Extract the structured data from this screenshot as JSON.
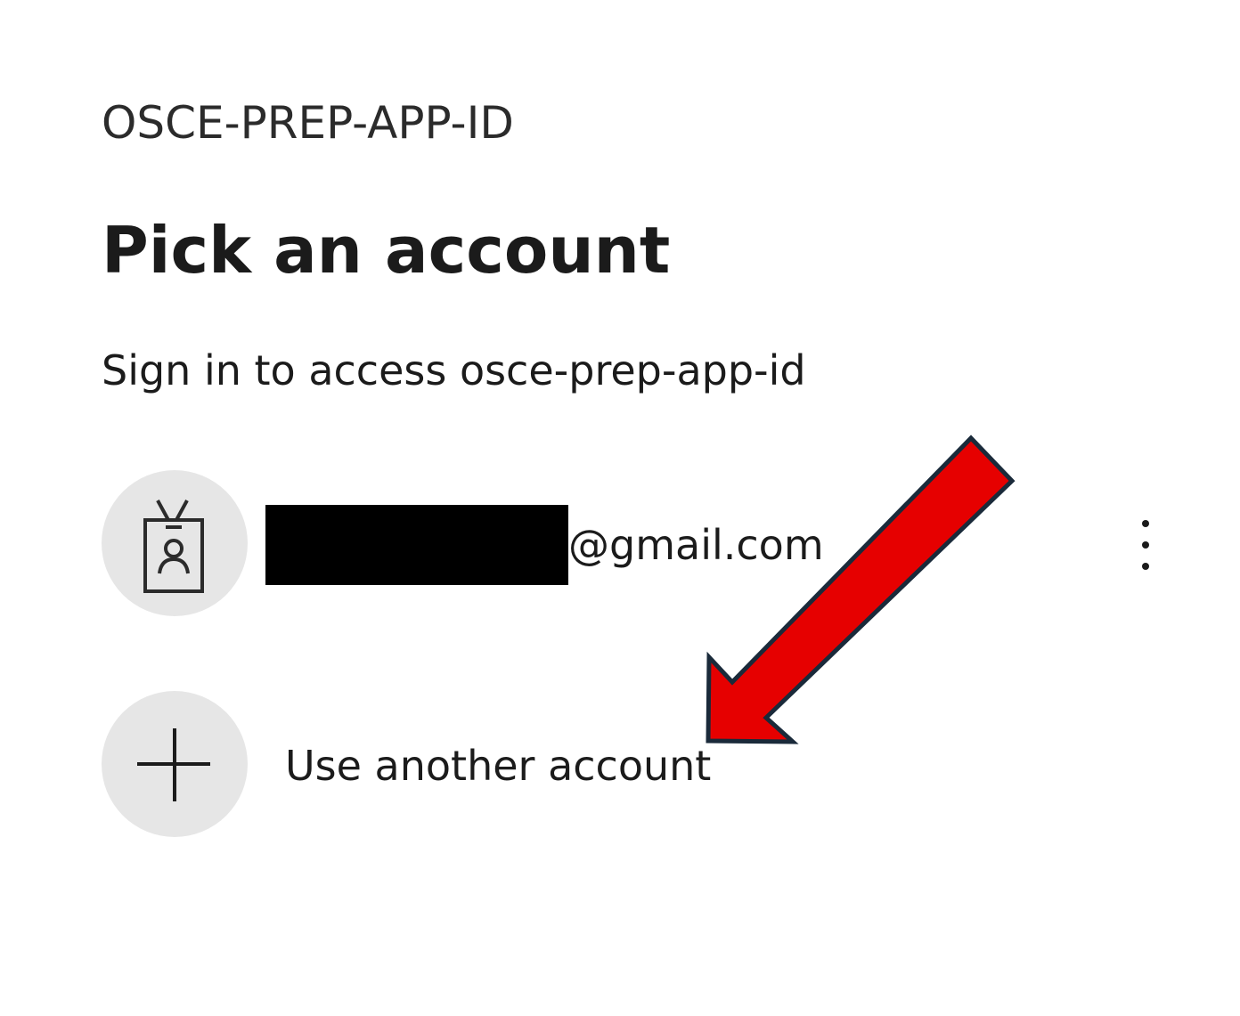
{
  "app": {
    "name": "OSCE-PREP-APP-ID"
  },
  "dialog": {
    "title": "Pick an account",
    "subtitle": "Sign in to access osce-prep-app-id"
  },
  "accounts": [
    {
      "email_domain": "@gmail.com",
      "redacted": true,
      "icon": "id-badge-icon"
    }
  ],
  "use_another": {
    "label": "Use another account",
    "icon": "plus-icon"
  },
  "more_options": {
    "icon": "vertical-ellipsis-icon"
  },
  "annotation": {
    "icon": "red-arrow-icon",
    "color": "#e60000",
    "outline_color": "#1a2a3a"
  },
  "colors": {
    "circle_bg": "#e6e6e6",
    "text": "#1b1b1b",
    "redaction": "#000000"
  }
}
